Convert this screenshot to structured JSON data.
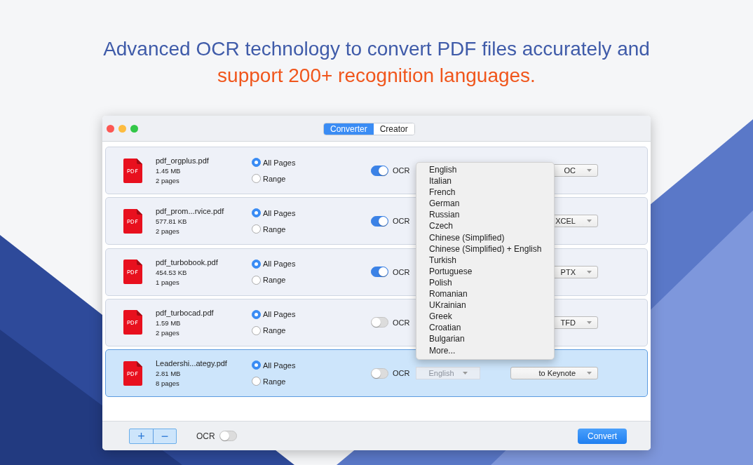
{
  "headline": {
    "text": "Advanced OCR technology to convert PDF files accurately and",
    "highlight": "support 200+ recognition languages."
  },
  "window": {
    "tabs": [
      {
        "label": "Converter",
        "selected": true
      },
      {
        "label": "Creator",
        "selected": false
      }
    ],
    "files": [
      {
        "name": "pdf_orgplus.pdf",
        "size": "1.45 MB",
        "pages": "2 pages",
        "page_options": [
          {
            "label": "All Pages",
            "selected": true
          },
          {
            "label": "Range",
            "selected": false
          }
        ],
        "ocr_label": "OCR",
        "ocr": true,
        "format": "OC",
        "selected": false
      },
      {
        "name": "pdf_prom...rvice.pdf",
        "size": "577.81 KB",
        "pages": "2 pages",
        "page_options": [
          {
            "label": "All Pages",
            "selected": true
          },
          {
            "label": "Range",
            "selected": false
          }
        ],
        "ocr_label": "OCR",
        "ocr": true,
        "format": "XCEL",
        "selected": false
      },
      {
        "name": "pdf_turbobook.pdf",
        "size": "454.53 KB",
        "pages": "1 pages",
        "page_options": [
          {
            "label": "All Pages",
            "selected": true
          },
          {
            "label": "Range",
            "selected": false
          }
        ],
        "ocr_label": "OCR",
        "ocr": true,
        "format": "PTX",
        "selected": false
      },
      {
        "name": "pdf_turbocad.pdf",
        "size": "1.59 MB",
        "pages": "2 pages",
        "page_options": [
          {
            "label": "All Pages",
            "selected": true
          },
          {
            "label": "Range",
            "selected": false
          }
        ],
        "ocr_label": "OCR",
        "ocr": false,
        "format": "TFD",
        "selected": false
      },
      {
        "name": "Leadershi...ategy.pdf",
        "size": "2.81 MB",
        "pages": "8 pages",
        "page_options": [
          {
            "label": "All Pages",
            "selected": true
          },
          {
            "label": "Range",
            "selected": false
          }
        ],
        "ocr_label": "OCR",
        "ocr": false,
        "language": "English",
        "format": "to Keynote",
        "selected": true
      }
    ],
    "language_menu": {
      "items": [
        "English",
        "Italian",
        "French",
        "German",
        "Russian",
        "Czech",
        "Chinese (Simplified)",
        "Chinese (Simplified) + English",
        "Turkish",
        "Portuguese",
        "Polish",
        "Romanian",
        "UKrainian",
        "Greek",
        "Croatian",
        "Bulgarian",
        "More..."
      ]
    },
    "bottom_bar": {
      "add": "+",
      "remove": "−",
      "ocr_label": "OCR",
      "ocr": false,
      "convert": "Convert"
    }
  }
}
